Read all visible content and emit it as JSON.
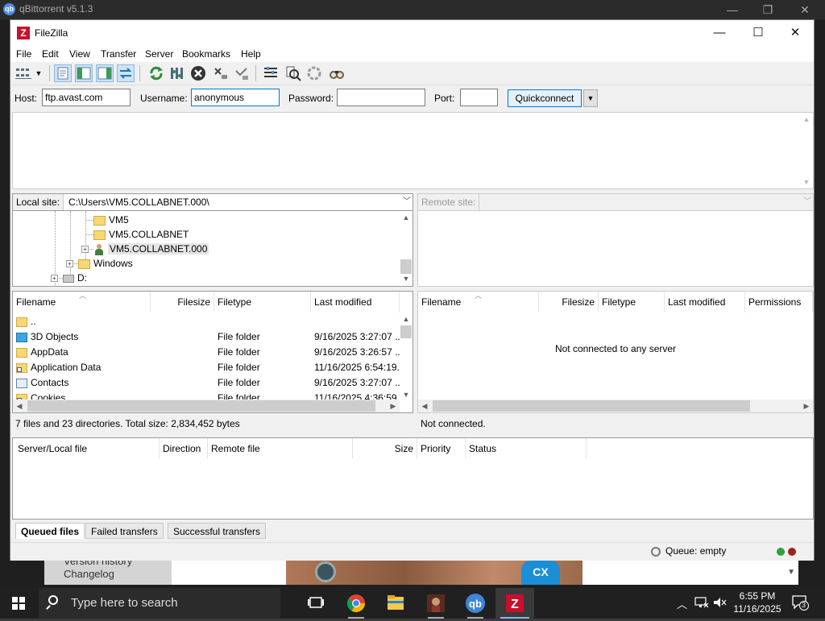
{
  "background_window": {
    "title": "qBittorrent v5.1.3",
    "logo": "qb",
    "sidebar_line1": "Version history",
    "sidebar_line2": "Changelog",
    "badge": "CX"
  },
  "window": {
    "title": "FileZilla",
    "logo": "Z",
    "minimize": "—",
    "maximize": "☐",
    "close": "✕"
  },
  "menu": [
    "File",
    "Edit",
    "View",
    "Transfer",
    "Server",
    "Bookmarks",
    "Help"
  ],
  "quickconnect": {
    "host_label": "Host:",
    "host_value": "ftp.avast.com",
    "username_label": "Username:",
    "username_value": "anonymous",
    "password_label": "Password:",
    "password_value": "",
    "port_label": "Port:",
    "port_value": "",
    "button_label": "Quickconnect"
  },
  "local": {
    "site_label": "Local site:",
    "path": "C:\\Users\\VM5.COLLABNET.000\\",
    "tree": [
      "VM5",
      "VM5.COLLABNET",
      "VM5.COLLABNET.000",
      "Windows",
      "D:"
    ],
    "columns": [
      "Filename",
      "Filesize",
      "Filetype",
      "Last modified"
    ],
    "files": [
      {
        "name": "..",
        "size": "",
        "type": "",
        "modified": "",
        "icon": "folder-icon"
      },
      {
        "name": "3D Objects",
        "size": "",
        "type": "File folder",
        "modified": "9/16/2025 3:27:07 ...",
        "icon": "3d-objects-icon"
      },
      {
        "name": "AppData",
        "size": "",
        "type": "File folder",
        "modified": "9/16/2025 3:26:57 ...",
        "icon": "folder-icon"
      },
      {
        "name": "Application Data",
        "size": "",
        "type": "File folder",
        "modified": "11/16/2025 6:54:19...",
        "icon": "folder-shortcut-icon"
      },
      {
        "name": "Contacts",
        "size": "",
        "type": "File folder",
        "modified": "9/16/2025 3:27:07 ...",
        "icon": "contacts-icon"
      },
      {
        "name": "Cookies",
        "size": "",
        "type": "File folder",
        "modified": "11/16/2025 4:36:59...",
        "icon": "folder-shortcut-icon"
      }
    ],
    "status": "7 files and 23 directories. Total size: 2,834,452 bytes"
  },
  "remote": {
    "site_label": "Remote site:",
    "columns": [
      "Filename",
      "Filesize",
      "Filetype",
      "Last modified",
      "Permissions"
    ],
    "message": "Not connected to any server",
    "status": "Not connected."
  },
  "queue": {
    "columns": [
      "Server/Local file",
      "Direction",
      "Remote file",
      "Size",
      "Priority",
      "Status"
    ],
    "tabs": [
      "Queued files",
      "Failed transfers",
      "Successful transfers"
    ],
    "status": "Queue: empty"
  },
  "taskbar": {
    "search_placeholder": "Type here to search",
    "time": "6:55 PM",
    "date": "11/16/2025",
    "notification_count": "3"
  },
  "colors": {
    "filezilla_red": "#c8102e",
    "accent_blue": "#0078d7",
    "taskbar": "#202020"
  }
}
